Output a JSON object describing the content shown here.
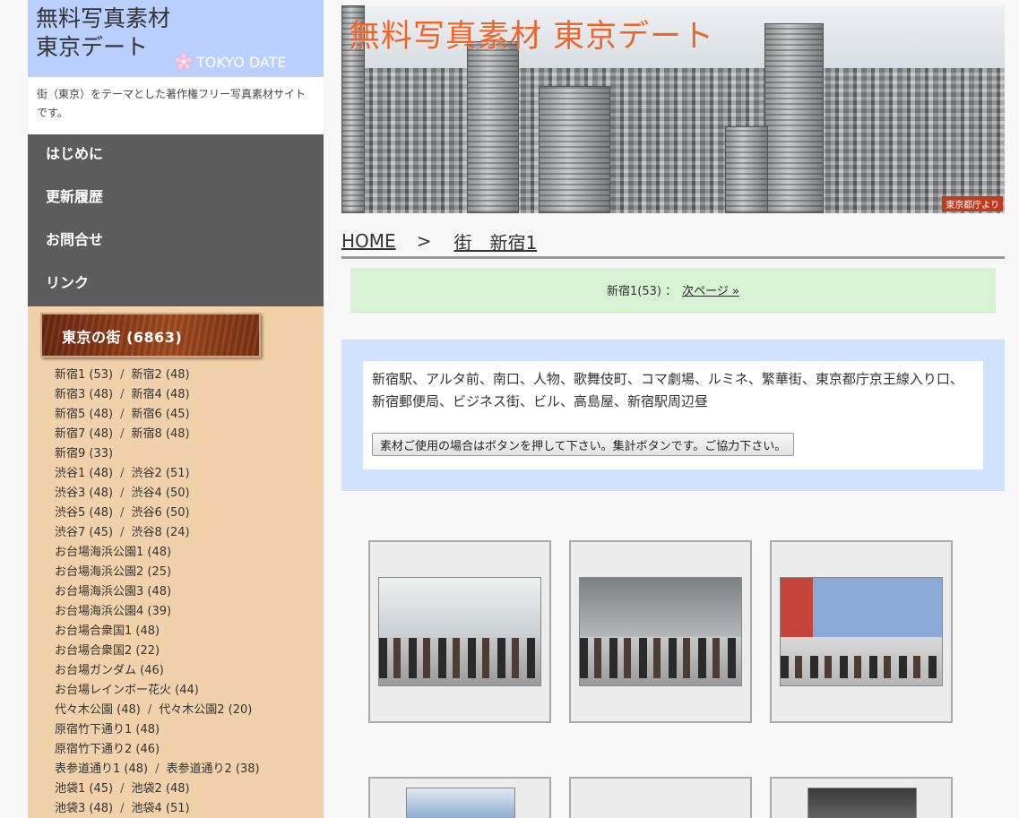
{
  "logo": {
    "line1": "無料写真素材",
    "line2": "東京デート",
    "sub": "TOKYO DATE"
  },
  "tagline": "街（東京）をテーマとした著作権フリー写真素材サイトです。",
  "nav": [
    {
      "label": "はじめに"
    },
    {
      "label": "更新履歴"
    },
    {
      "label": "お問合せ"
    },
    {
      "label": "リンク"
    }
  ],
  "category_header": "東京の街 (6863)",
  "categories": [
    [
      "新宿1 (53)",
      "新宿2 (48)"
    ],
    [
      "新宿3 (48)",
      "新宿4 (48)"
    ],
    [
      "新宿5 (48)",
      "新宿6 (45)"
    ],
    [
      "新宿7 (48)",
      "新宿8 (48)"
    ],
    [
      "新宿9 (33)"
    ],
    [
      "渋谷1 (48)",
      "渋谷2 (51)"
    ],
    [
      "渋谷3 (48)",
      "渋谷4 (50)"
    ],
    [
      "渋谷5 (48)",
      "渋谷6 (50)"
    ],
    [
      "渋谷7 (45)",
      "渋谷8 (24)"
    ],
    [
      "お台場海浜公園1 (48)"
    ],
    [
      "お台場海浜公園2 (25)"
    ],
    [
      "お台場海浜公園3 (48)"
    ],
    [
      "お台場海浜公園4 (39)"
    ],
    [
      "お台場合衆国1 (48)"
    ],
    [
      "お台場合衆国2 (22)"
    ],
    [
      "お台場ガンダム (46)"
    ],
    [
      "お台場レインボー花火 (44)"
    ],
    [
      "代々木公園 (48)",
      "代々木公園2 (20)"
    ],
    [
      "原宿竹下通り1 (48)"
    ],
    [
      "原宿竹下通り2 (46)"
    ],
    [
      "表参道通り1 (48)",
      "表参道通り2 (38)"
    ],
    [
      "池袋1 (45)",
      "池袋2 (48)"
    ],
    [
      "池袋3 (48)",
      "池袋4 (51)"
    ]
  ],
  "banner": {
    "title": "無料写真素材 東京デート",
    "credit": "東京都庁より"
  },
  "breadcrumb": {
    "home": "HOME",
    "separator": ">",
    "current": "街　新宿1"
  },
  "pager": {
    "current": "新宿1(53) ：",
    "next": "次ページ »"
  },
  "description": "新宿駅、アルタ前、南口、人物、歌舞伎町、コマ劇場、ルミネ、繁華街、東京都庁京王線入り口、新宿郵便局、ビジネス街、ビル、高島屋、新宿駅周辺昼",
  "count_button": "素材ご使用の場合はボタンを押して下さい。集計ボタンです。ご協力下さい。",
  "colors": {
    "logo_bg": "#b9cffd",
    "nav_bg": "#5c5c5c",
    "category_bg": "#f0d1a9",
    "pager_bg": "#d7f3d3",
    "desc_bg": "#d0e3fc",
    "banner_title": "#f0642a"
  }
}
